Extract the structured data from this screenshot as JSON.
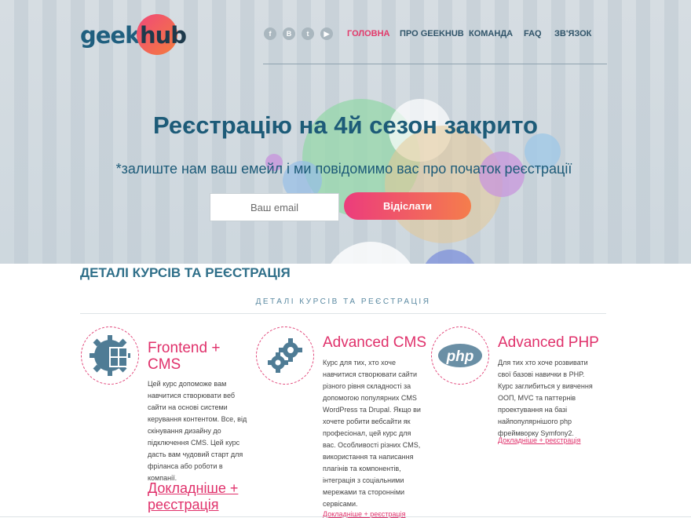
{
  "header": {
    "logo_part1": "geek",
    "logo_part2": "hub",
    "social": [
      {
        "icon": "facebook-icon",
        "glyph": "f"
      },
      {
        "icon": "vk-icon",
        "glyph": "B"
      },
      {
        "icon": "twitter-icon",
        "glyph": "t"
      },
      {
        "icon": "youtube-icon",
        "glyph": "▶"
      }
    ],
    "nav": [
      "ГОЛОВНА",
      "ПРО GEEKHUB",
      "КОМАНДА",
      "FAQ",
      "ЗВ'ЯЗОК"
    ],
    "active_nav": "ГОЛОВНА"
  },
  "hero": {
    "title": "Реєстрацію на 4й сезон закрито",
    "subtitle": "*залиште нам ваш емейл і ми повідомимо вас про початок реєстрації",
    "email_placeholder": "Ваш email",
    "send_label": "Відіслати"
  },
  "section": {
    "title": "ДЕТАЛІ КУРСІВ ТА РЕЄСТРАЦІЯ",
    "subtitle": "ДЕТАЛІ КУРСІВ ТА РЕЄСТРАЦІЯ"
  },
  "courses": [
    {
      "icon": "frontend-cms-gear-icon",
      "title": "Frontend + CMS",
      "description": "Цей курс допоможе вам навчитися створювати веб сайти на основі системи керування контентом. Все, від скінування дизайну до підключення CMS. Цей курс дасть вам чудовий старт для фріланса або роботи в компанії.",
      "link": "Докладніше + реєстрація"
    },
    {
      "icon": "gears-icon",
      "title": "Advanced CMS",
      "description": "Курс для тих, хто хоче навчитися створювати сайти різного рівня складності за допомогою популярних CMS WordPress та Drupal. Якщо ви хочете робити вебсайти як професіонал, цей курс для вас. Особливості різних CMS, використання та написання плагінів та компонентів, інтеграція з соціальними мережами та сторонніми сервісами.",
      "link": "Докладніше + реєстрація"
    },
    {
      "icon": "php-icon",
      "title": "Advanced PHP",
      "description": "Для тих хто хоче розвивати свої базові навички в PHP. Курс заглибиться у вивчення ООП, MVC та паттернів проектування на базі найпопулярнішого php фреймворку Symfony2.",
      "link": "Докладніше + реєстрація"
    }
  ],
  "colors": {
    "accent": "#e0316b",
    "brand_blue": "#1d5b78",
    "button_gradient_start": "#ec3c7c",
    "button_gradient_end": "#f57d4c"
  }
}
